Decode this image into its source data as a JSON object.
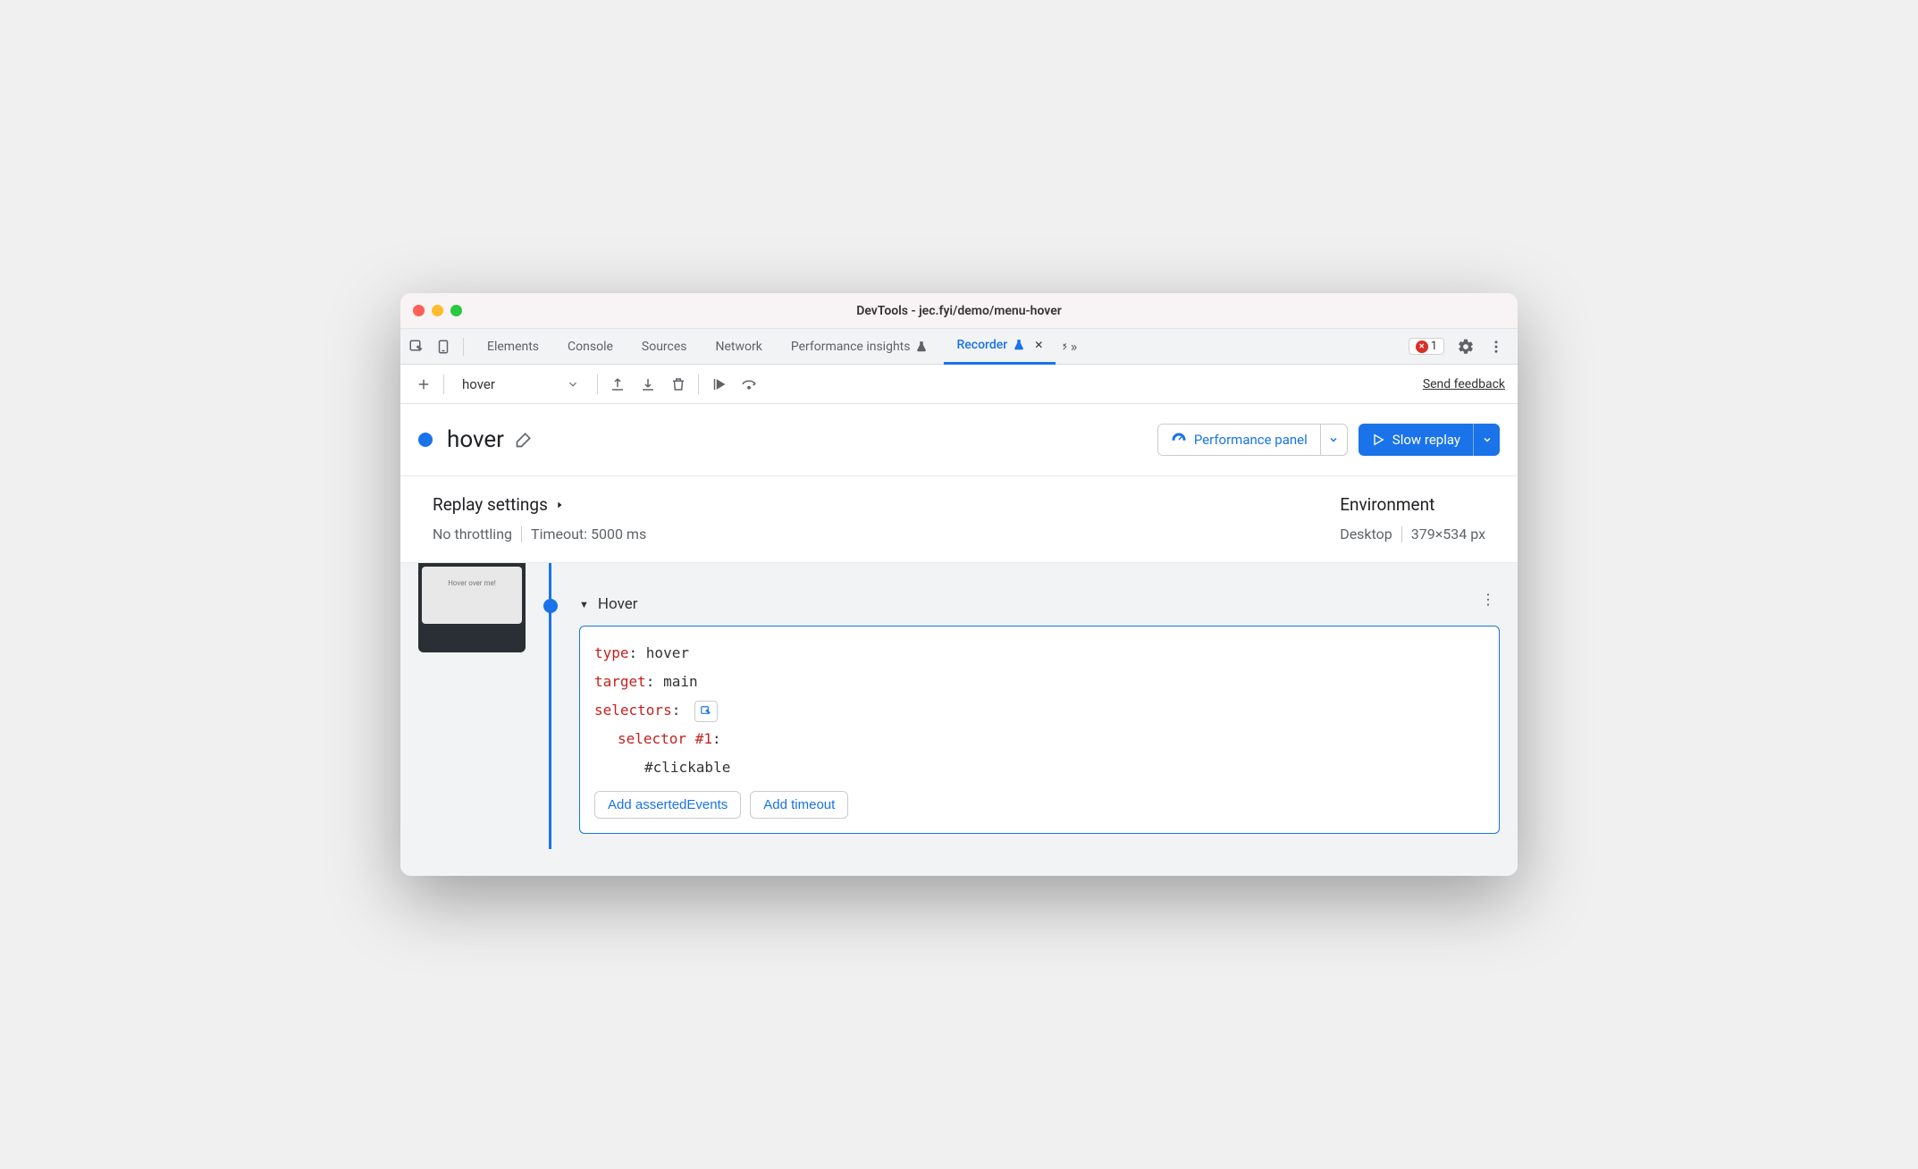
{
  "window": {
    "title": "DevTools - jec.fyi/demo/menu-hover"
  },
  "tabs": {
    "elements": "Elements",
    "console": "Console",
    "sources": "Sources",
    "network": "Network",
    "perf_insights": "Performance insights",
    "recorder": "Recorder"
  },
  "errors": {
    "count": "1"
  },
  "toolbar": {
    "recording_name": "hover",
    "feedback": "Send feedback"
  },
  "recording": {
    "title": "hover",
    "perf_panel": "Performance panel",
    "slow_replay": "Slow replay"
  },
  "settings": {
    "replay_title": "Replay settings",
    "throttling": "No throttling",
    "timeout": "Timeout: 5000 ms",
    "env_title": "Environment",
    "device": "Desktop",
    "viewport": "379×534 px"
  },
  "thumb": {
    "caption": "Hover over me!"
  },
  "step": {
    "title": "Hover",
    "type_key": "type",
    "type_val": "hover",
    "target_key": "target",
    "target_val": "main",
    "selectors_key": "selectors",
    "selector_n_key": "selector #1",
    "selector_n_val": "#clickable",
    "add_asserted": "Add assertedEvents",
    "add_timeout": "Add timeout"
  }
}
